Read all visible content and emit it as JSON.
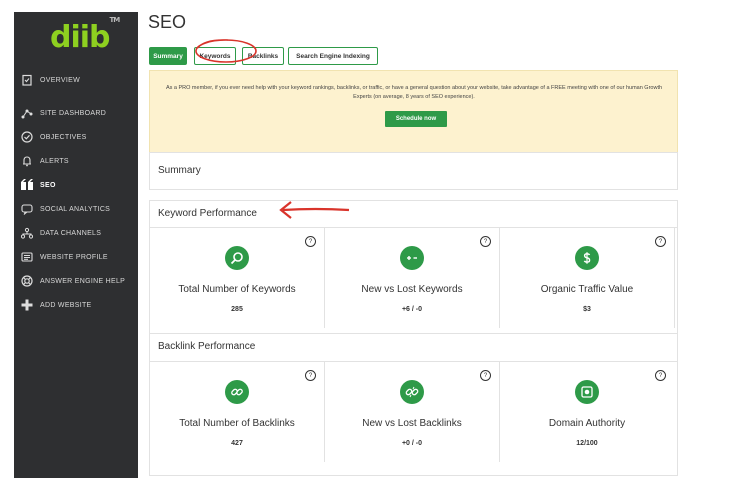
{
  "brand": {
    "logo": "diib",
    "tm": "TM",
    "accent": "#8ed020"
  },
  "sidebar": {
    "items": [
      {
        "label": "OVERVIEW",
        "icon": "clipboard-icon"
      },
      {
        "label": "SITE DASHBOARD",
        "icon": "nodes-icon"
      },
      {
        "label": "OBJECTIVES",
        "icon": "check-circle-icon"
      },
      {
        "label": "ALERTS",
        "icon": "bell-icon"
      },
      {
        "label": "SEO",
        "icon": "quote-icon"
      },
      {
        "label": "SOCIAL ANALYTICS",
        "icon": "chat-icon"
      },
      {
        "label": "DATA CHANNELS",
        "icon": "network-icon"
      },
      {
        "label": "WEBSITE PROFILE",
        "icon": "profile-card-icon"
      },
      {
        "label": "ANSWER ENGINE HELP",
        "icon": "lifebuoy-icon"
      },
      {
        "label": "ADD WEBSITE",
        "icon": "plus-icon"
      }
    ],
    "active": "SEO"
  },
  "page": {
    "title": "SEO"
  },
  "tabs": {
    "summary": "Summary",
    "keywords": "Keywords",
    "backlinks": "Backlinks",
    "indexing": "Search Engine Indexing"
  },
  "promo": {
    "text": "As a PRO member, if you ever need help with your keyword rankings, backlinks, or traffic, or have a general question about your website, take advantage of a FREE meeting with one of our human Growth Experts (on average, 8 years of SEO experience).",
    "button": "Schedule now"
  },
  "summary": {
    "title": "Summary"
  },
  "keyword_performance": {
    "title": "Keyword Performance",
    "cells": [
      {
        "label": "Total Number of Keywords",
        "value": "285",
        "icon": "search-icon"
      },
      {
        "label": "New vs Lost Keywords",
        "value": "+6 / -0",
        "icon": "plus-minus-icon"
      },
      {
        "label": "Organic Traffic Value",
        "value": "$3",
        "icon": "dollar-icon"
      }
    ]
  },
  "backlink_performance": {
    "title": "Backlink Performance",
    "cells": [
      {
        "label": "Total Number of Backlinks",
        "value": "427",
        "icon": "link-icon"
      },
      {
        "label": "New vs Lost Backlinks",
        "value": "+0 / -0",
        "icon": "broken-link-icon"
      },
      {
        "label": "Domain Authority",
        "value": "12/100",
        "icon": "authority-icon"
      }
    ]
  },
  "help_glyph": "?",
  "colors": {
    "green": "#2e9a48",
    "sidebar": "#2e2f31",
    "promo": "#fdf2cf",
    "annotation": "#d9342b"
  }
}
